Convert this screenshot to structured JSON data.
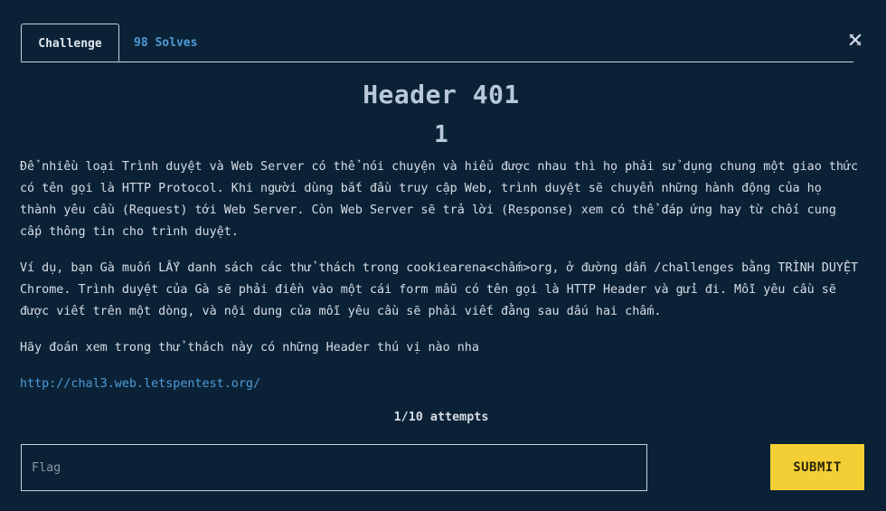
{
  "tabs": {
    "challenge_label": "Challenge",
    "solves_label": "98 Solves"
  },
  "challenge": {
    "name": "Header 401",
    "points": "1",
    "description": {
      "p1": "Để nhiều loại Trình duyệt và Web Server có thể nói chuyện và hiểu được nhau thì họ phải sử dụng chung một giao thức có tên gọi là HTTP Protocol. Khi người dùng bắt đầu truy cập Web, trình duyệt sẽ chuyển những hành động của họ thành yêu cầu (Request) tới Web Server. Còn Web Server sẽ trả lời (Response) xem có thể đáp ứng hay từ chối cung cấp thông tin cho trình duyệt.",
      "p2": "Ví dụ, bạn Gà muốn LẤY danh sách các thử thách trong cookiearena<chấm>org, ở đường dẫn /challenges bằng TRÌNH DUYỆT Chrome. Trình duyệt của Gà sẽ phải điền vào một cái form mẫu có tên gọi là HTTP Header và gửi đi. Mỗi yêu cầu sẽ được viết trên một dòng, và nội dung của mỗi yêu cầu sẽ phải viết đằng sau dấu hai chấm.",
      "p3": "Hãy đoán xem trong thử thách này có những Header thú vị nào nha",
      "link": "http://chal3.web.letspentest.org/"
    },
    "attempts": "1/10 attempts"
  },
  "form": {
    "flag_placeholder": "Flag",
    "flag_value": "",
    "submit_label": "SUBMIT"
  },
  "icons": {
    "close": "close-icon"
  },
  "colors": {
    "background": "#0b2236",
    "accent_link": "#4f9ad8",
    "submit_bg": "#f3cf35",
    "text": "#d6dde6"
  }
}
